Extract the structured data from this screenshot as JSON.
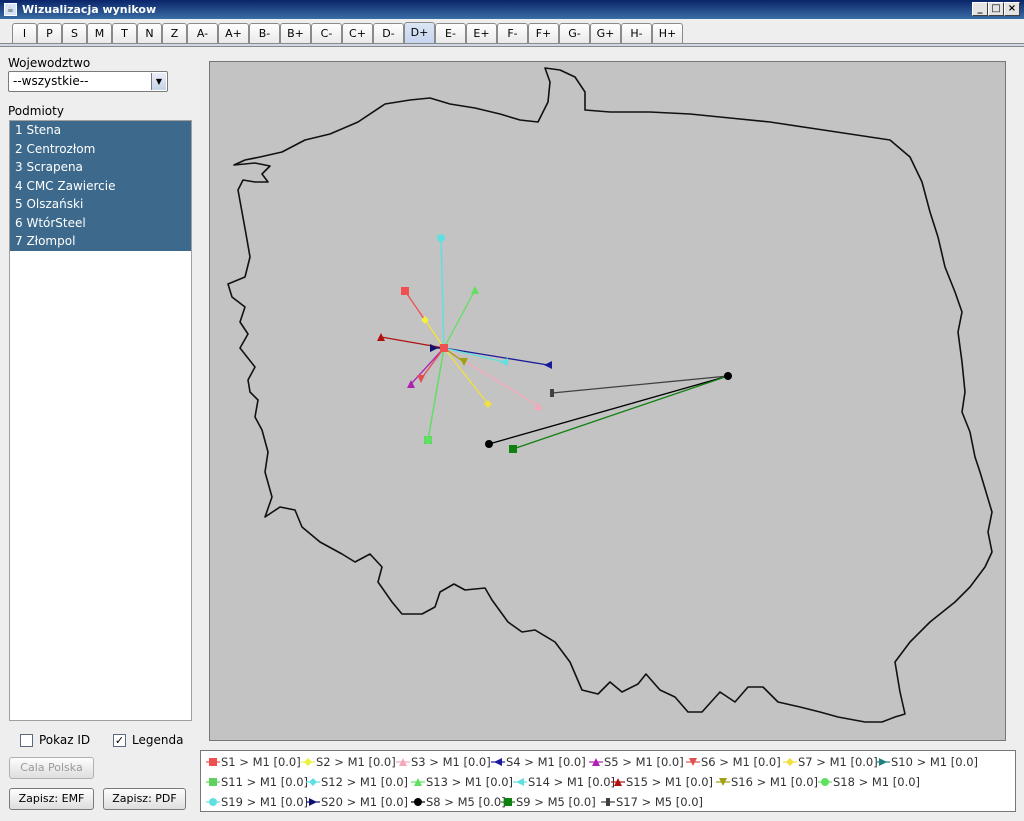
{
  "window": {
    "title": "Wizualizacja wynikow"
  },
  "tabs": [
    "I",
    "P",
    "S",
    "M",
    "T",
    "N",
    "Z",
    "A-",
    "A+",
    "B-",
    "B+",
    "C-",
    "C+",
    "D-",
    "D+",
    "E-",
    "E+",
    "F-",
    "F+",
    "G-",
    "G+",
    "H-",
    "H+"
  ],
  "active_tab": "D+",
  "left": {
    "wojewodztwo_label": "Wojewodztwo",
    "wojewodztwo_value": "--wszystkie--",
    "podmioty_label": "Podmioty",
    "podmioty": [
      "1 Stena",
      "2 Centrozłom",
      "3 Scrapena",
      "4 CMC Zawiercie",
      "5 Olszański",
      "6 WtórSteel",
      "7 Złompol"
    ],
    "pokaz_id_label": "Pokaz ID",
    "pokaz_id_checked": false,
    "legenda_label": "Legenda",
    "legenda_checked": true,
    "cala_polska_label": "Cala Polska",
    "zapisz_emf_label": "Zapisz: EMF",
    "zapisz_pdf_label": "Zapisz: PDF"
  },
  "legend": [
    {
      "label": "S1 > M1 [0.0]",
      "color": "#f05050",
      "marker": "square"
    },
    {
      "label": "S2 > M1 [0.0]",
      "color": "#f0f040",
      "marker": "diamond"
    },
    {
      "label": "S3 > M1 [0.0]",
      "color": "#f5a8b8",
      "marker": "up"
    },
    {
      "label": "S4 > M1 [0.0]",
      "color": "#1a1a9a",
      "marker": "left"
    },
    {
      "label": "S5 > M1 [0.0]",
      "color": "#b020b0",
      "marker": "up"
    },
    {
      "label": "S6 > M1 [0.0]",
      "color": "#e05050",
      "marker": "down"
    },
    {
      "label": "S7 > M1 [0.0]",
      "color": "#f0e040",
      "marker": "diamond"
    },
    {
      "label": "S10 > M1 [0.0]",
      "color": "#208080",
      "marker": "right"
    },
    {
      "label": "S11 > M1 [0.0]",
      "color": "#60d060",
      "marker": "square"
    },
    {
      "label": "S12 > M1 [0.0]",
      "color": "#60e0e0",
      "marker": "diamond"
    },
    {
      "label": "S13 > M1 [0.0]",
      "color": "#60e060",
      "marker": "up"
    },
    {
      "label": "S14 > M1 [0.0]",
      "color": "#60e0e0",
      "marker": "left"
    },
    {
      "label": "S15 > M1 [0.0]",
      "color": "#b01010",
      "marker": "up"
    },
    {
      "label": "S16 > M1 [0.0]",
      "color": "#a0a010",
      "marker": "down"
    },
    {
      "label": "S18 > M1 [0.0]",
      "color": "#60e060",
      "marker": "circle"
    },
    {
      "label": "S19 > M1 [0.0]",
      "color": "#60e0e0",
      "marker": "circle"
    },
    {
      "label": "S20 > M1 [0.0]",
      "color": "#101070",
      "marker": "right"
    },
    {
      "label": "S8 > M5 [0.0]",
      "color": "#000000",
      "marker": "circle"
    },
    {
      "label": "S9 > M5 [0.0]",
      "color": "#108010",
      "marker": "square"
    },
    {
      "label": "S17 > M5 [0.0]",
      "color": "#404040",
      "marker": "bar"
    }
  ]
}
